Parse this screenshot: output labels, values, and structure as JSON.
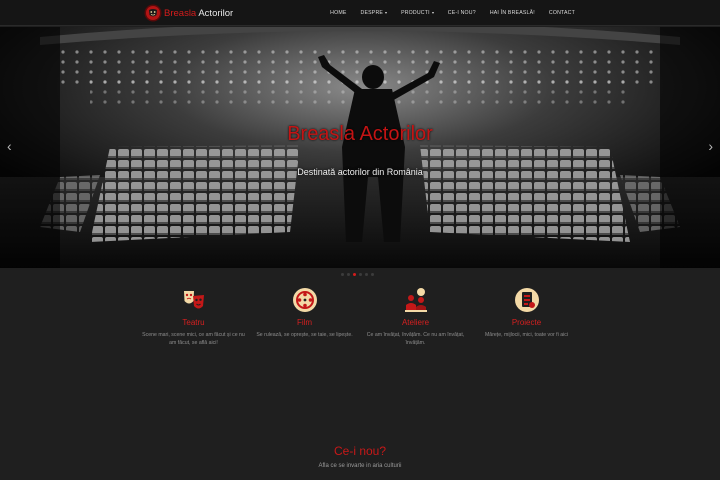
{
  "brand": {
    "name_part1": "Breasla",
    "name_part2": "Actorilor",
    "logo_icon": "theater-mask-logo"
  },
  "nav": {
    "items": [
      {
        "label": "HOME",
        "dropdown": false
      },
      {
        "label": "DESPRE",
        "dropdown": true
      },
      {
        "label": "PRODUCTI",
        "dropdown": true
      },
      {
        "label": "CE-I NOU?",
        "dropdown": false
      },
      {
        "label": "HAI ÎN BREASLĂ!",
        "dropdown": false
      },
      {
        "label": "CONTACT",
        "dropdown": false
      }
    ]
  },
  "hero": {
    "title": "Breasla Actorilor",
    "subtitle": "Destinată actorilor din România",
    "prev_icon": "chevron-left-icon",
    "next_icon": "chevron-right-icon",
    "slide_count": 6,
    "active_slide": 2
  },
  "features": [
    {
      "title": "Teatru",
      "desc": "Scene mari, scene mici, ce am făcut și ce nu am făcut, se află aici!",
      "icon": "theater-masks-icon"
    },
    {
      "title": "Film",
      "desc": "Se rulează, se oprește, se taie, se lipește.",
      "icon": "film-reel-icon"
    },
    {
      "title": "Ateliere",
      "desc": "Ce am învățat, învățăm. Ce nu am învățat, învățăm.",
      "icon": "workshop-icon"
    },
    {
      "title": "Proiecte",
      "desc": "Mărețe, mijlocii, mici, toate vor fi aici",
      "icon": "projects-icon"
    }
  ],
  "news": {
    "title": "Ce-i nou?",
    "subtitle": "Afla ce se invarte in aria culturii"
  },
  "colors": {
    "accent": "#d31c1c",
    "background": "#1f1f1f",
    "navbar": "#151515",
    "icon_bg": "#f3d9a6"
  }
}
